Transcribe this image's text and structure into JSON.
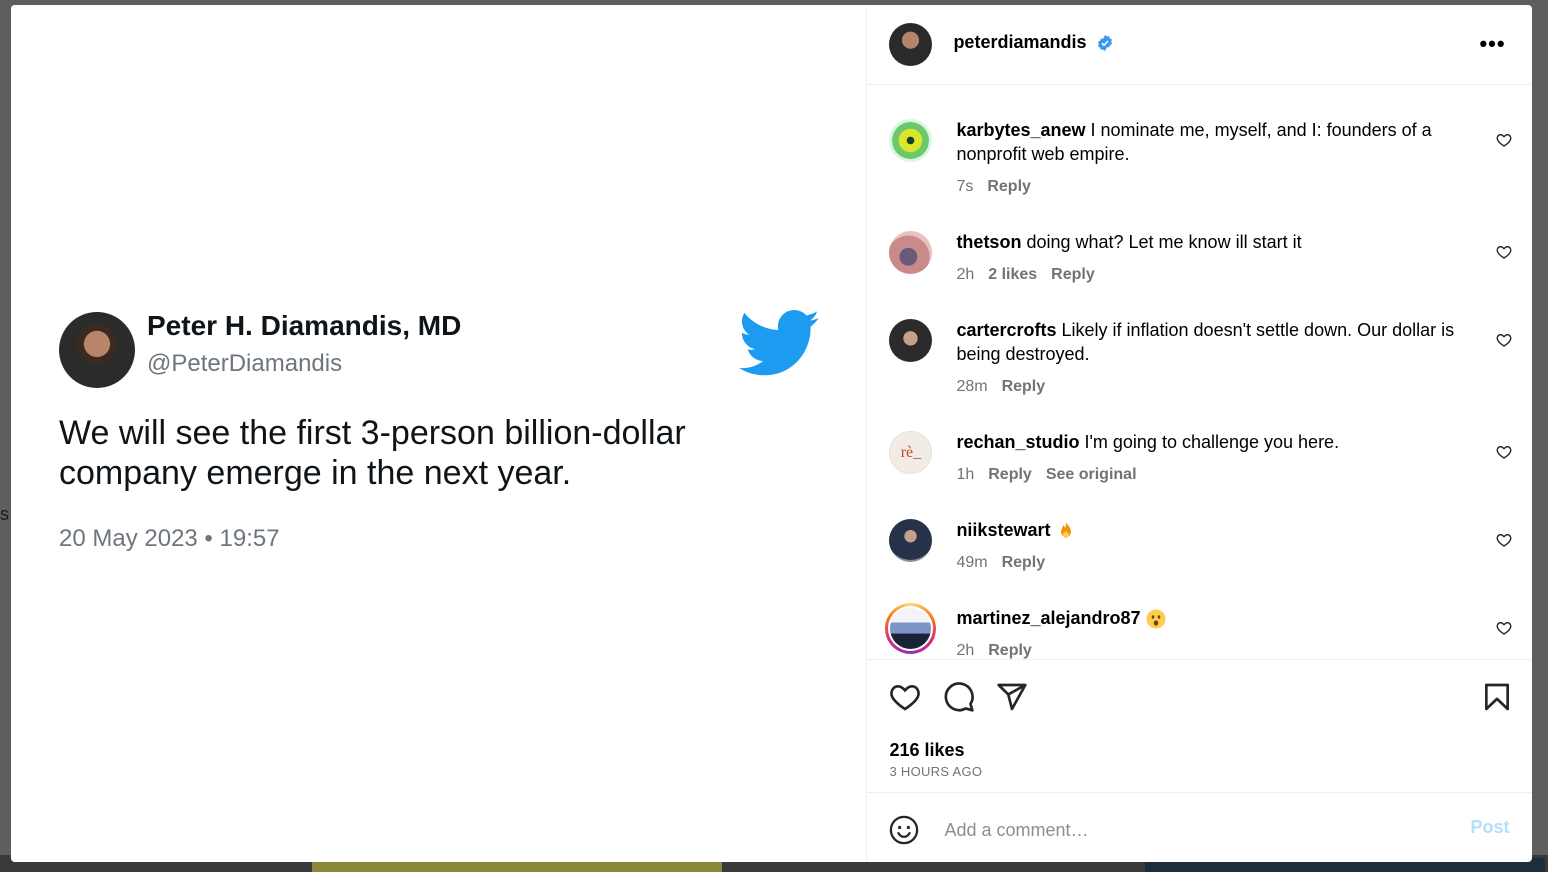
{
  "backdrop": {
    "edge_text": "s"
  },
  "tweet": {
    "author_name": "Peter H. Diamandis, MD",
    "handle": "@PeterDiamandis",
    "text": "We will see the first 3-person billion-dollar company emerge in the next year.",
    "date": "20 May 2023 • 19:57",
    "bird_color": "#1d9bf0"
  },
  "post": {
    "owner": "peterdiamandis",
    "more_label": "•••",
    "likes": "216 likes",
    "time_ago": "3 HOURS AGO"
  },
  "comments": [
    {
      "user": "karbytes_anew",
      "text": " I nominate me, myself, and I: founders of a nonprofit web empire.",
      "time": "7s",
      "reply": "Reply"
    },
    {
      "user": "thetson",
      "text": " doing what? Let me know ill start it",
      "time": "2h",
      "likes": "2 likes",
      "reply": "Reply"
    },
    {
      "user": "cartercrofts",
      "text": " Likely if inflation doesn't settle down. Our dollar is being destroyed.",
      "time": "28m",
      "reply": "Reply"
    },
    {
      "user": "rechan_studio",
      "text": " I'm going to challenge you here.",
      "time": "1h",
      "reply": "Reply",
      "see_original": "See original",
      "avatar_text": "rè_"
    },
    {
      "user": "niikstewart",
      "time": "49m",
      "reply": "Reply",
      "emoji": "fire-emoji"
    },
    {
      "user": "martinez_alejandro87",
      "time": "2h",
      "reply": "Reply",
      "emoji": "astonished-emoji"
    }
  ],
  "composer": {
    "placeholder": "Add a comment…",
    "post_label": "Post"
  },
  "colors": {
    "accent": "#0095f6",
    "verified": "#3897f0",
    "post_disabled": "#b2dffc"
  }
}
